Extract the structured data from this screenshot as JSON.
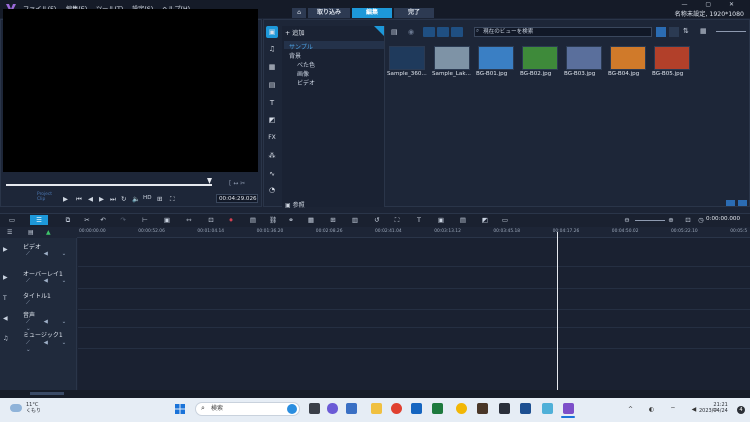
{
  "menu": {
    "items": [
      "ファイル(F)",
      "編集(E)",
      "ツール(T)",
      "設定(S)",
      "ヘルプ(H)"
    ],
    "tabs": [
      "取り込み",
      "編集",
      "完了"
    ],
    "active_tab": "編集",
    "project_info": "名称未設定, 1920*1080"
  },
  "preview": {
    "project_label": "Project",
    "clip_label": "Clip",
    "timecode": "00:04:29.026"
  },
  "library": {
    "add_label": "追加",
    "tree": [
      "サンプル",
      "背景",
      "べた色",
      "画像",
      "ビデオ"
    ],
    "search_placeholder": "現在のビューを検索",
    "browse_label": "参照",
    "thumbnails": [
      {
        "label": "Sample_360...",
        "color": "#1f3a5c"
      },
      {
        "label": "Sample_Lak...",
        "color": "#7e93a6"
      },
      {
        "label": "BG-B01.jpg",
        "color": "#3a7fc4"
      },
      {
        "label": "BG-B02.jpg",
        "color": "#3e8a3a"
      },
      {
        "label": "BG-B03.jpg",
        "color": "#5a6f9c"
      },
      {
        "label": "BG-B04.jpg",
        "color": "#d07a2a"
      },
      {
        "label": "BG-B05.jpg",
        "color": "#b2402a"
      }
    ]
  },
  "timeline": {
    "time": "0:00:00.000",
    "ruler": [
      "00:00:00.00",
      "00:00:52.06",
      "00:01:04.14",
      "00:01:36.20",
      "00:02:08.26",
      "00:02:41.04",
      "00:03:13.12",
      "00:03:45.18",
      "00:04:17.26",
      "00:04:50.02",
      "00:05:22.10",
      "00:05:5"
    ],
    "tracks": [
      {
        "name": "ビデオ",
        "icon": "video-icon"
      },
      {
        "name": "オーバーレイ1",
        "icon": "overlay-icon"
      },
      {
        "name": "タイトル1",
        "icon": "title-icon"
      },
      {
        "name": "音声",
        "icon": "audio-icon"
      },
      {
        "name": "ミュージック1",
        "icon": "music-icon"
      }
    ]
  },
  "taskbar": {
    "weather_temp": "11°C",
    "weather_desc": "くもり",
    "search_placeholder": "検索",
    "clock_time": "21:21",
    "clock_date": "2023/04/24"
  }
}
